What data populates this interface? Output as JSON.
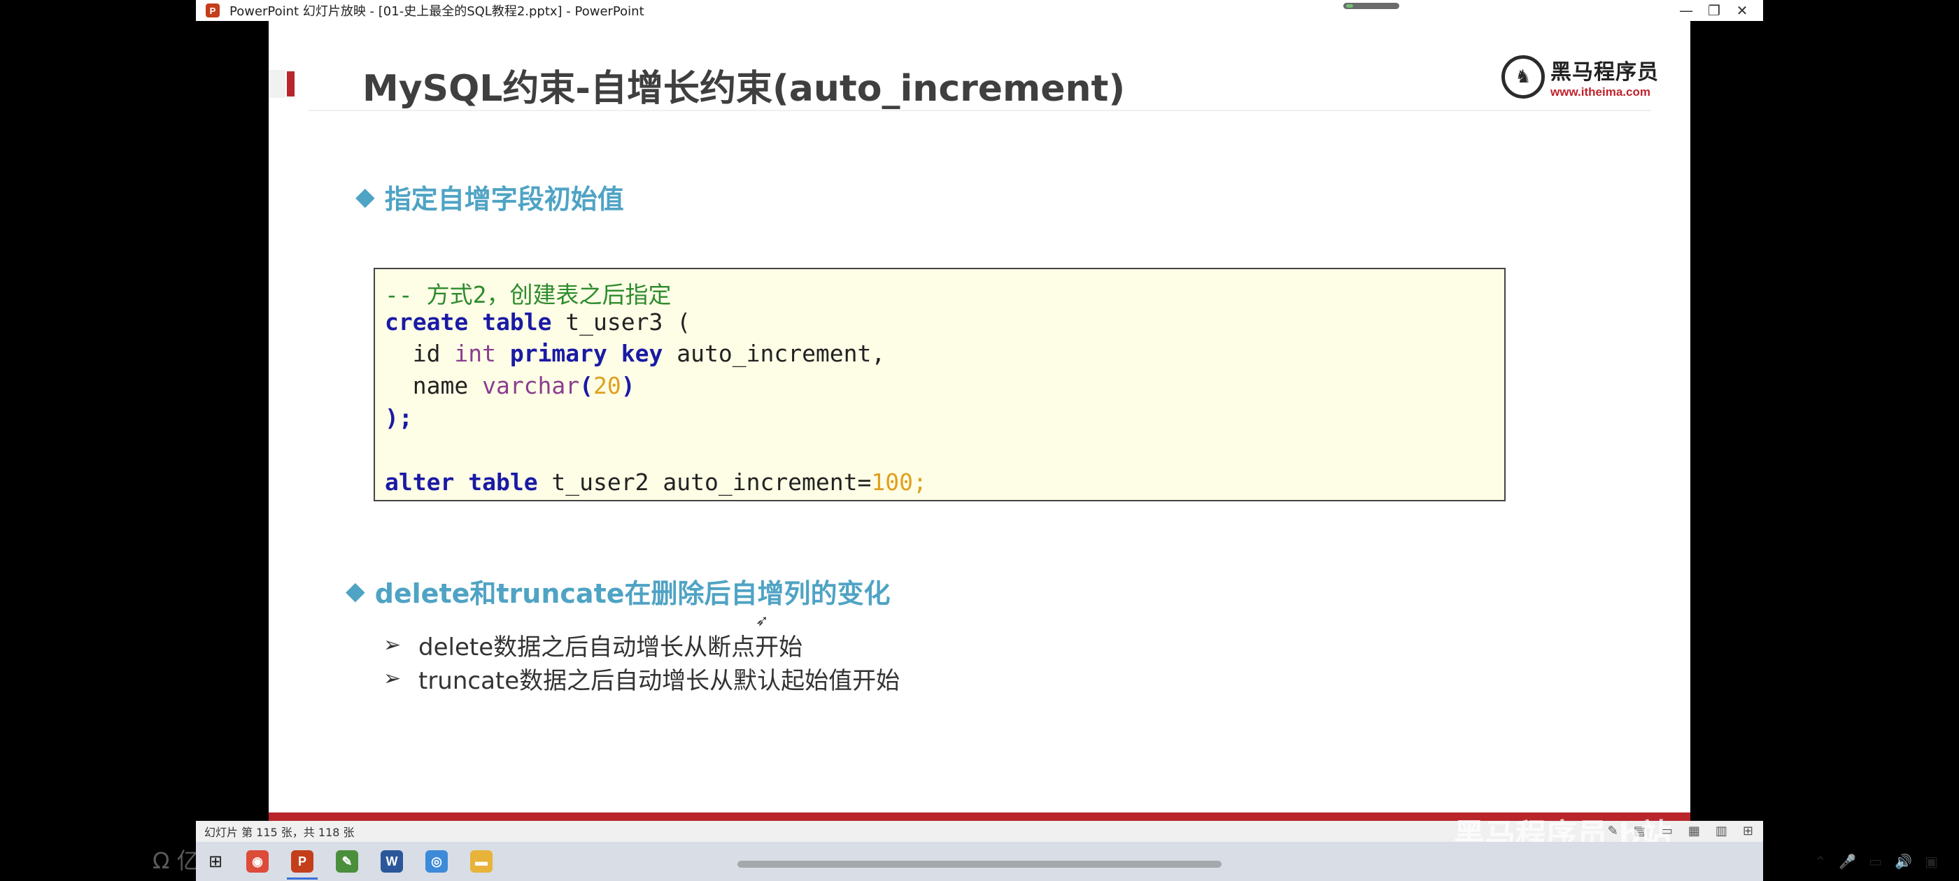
{
  "window": {
    "title": "PowerPoint 幻灯片放映 - [01-史上最全的SQL教程2.pptx] - PowerPoint",
    "app_icon_letter": "P",
    "controls": {
      "minimize": "—",
      "restore": "❐",
      "close": "✕"
    }
  },
  "slide": {
    "title": "MySQL约束-自增长约束(auto_increment)",
    "logo_text": "黑马程序员",
    "logo_url": "www.itheima.com",
    "section1": "指定自增字段初始值",
    "section2": "delete和truncate在删除后自增列的变化",
    "code": {
      "comment": "-- 方式2，创建表之后指定",
      "kw_create": "create",
      "kw_table": "table",
      "tbl3": " t_user3 (",
      "id_indent": "  id ",
      "type_int": "int",
      "kw_primary": "primary",
      "kw_key": "key",
      "auto_comma": " auto_increment,",
      "name_indent": "  name ",
      "type_varchar": "varchar",
      "paren_open": "(",
      "num_20": "20",
      "paren_close": ")",
      "close_stmt": ");",
      "kw_alter": "alter",
      "kw_table2": "table",
      "tbl2": " t_user2 auto_increment=",
      "num_100": "100",
      "semi": ";"
    },
    "bullets": [
      "delete数据之后自动增长从断点开始",
      "truncate数据之后自动增长从默认起始值开始"
    ]
  },
  "status": {
    "slide_counter": "幻灯片 第 115 张，共 118 张"
  },
  "watermark": {
    "left": "Ω 亿正在",
    "right": "黑马程序员 b站"
  },
  "taskbar": {
    "apps": [
      {
        "name": "chrome",
        "glyph": "◉",
        "color": "#dd4b39"
      },
      {
        "name": "powerpoint",
        "glyph": "P",
        "color": "#c43e1c",
        "active": true
      },
      {
        "name": "editor",
        "glyph": "✎",
        "color": "#4a8f3c"
      },
      {
        "name": "word",
        "glyph": "W",
        "color": "#2b579a"
      },
      {
        "name": "browser",
        "glyph": "◎",
        "color": "#3c8ad8"
      },
      {
        "name": "folder",
        "glyph": "▬",
        "color": "#e8b339"
      }
    ]
  }
}
